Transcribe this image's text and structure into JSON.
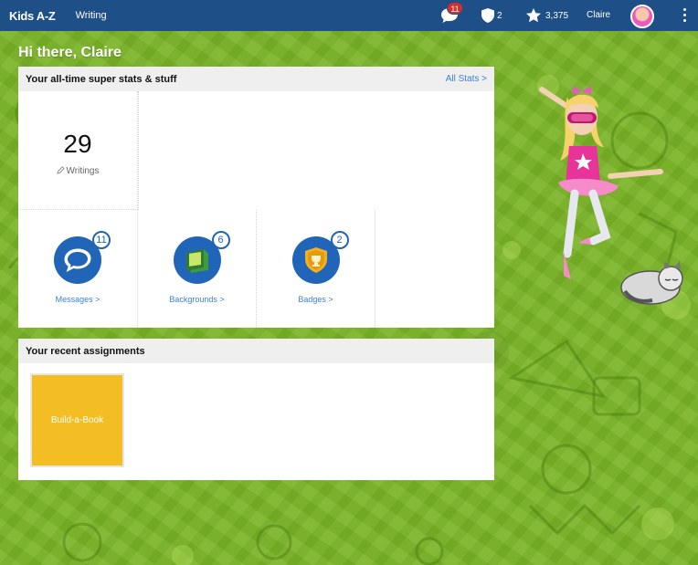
{
  "app": {
    "logo": "Kids A-Z",
    "mode": "Writing"
  },
  "topbar": {
    "messages_count": "11",
    "shields_count": "2",
    "stars_count": "3,375",
    "username": "Claire"
  },
  "greeting": "Hi there, Claire",
  "stats": {
    "title": "Your all-time super stats & stuff",
    "all_stats_link": "All Stats >",
    "writings_count": "29",
    "writings_label": "Writings",
    "messages": {
      "count": "11",
      "label": "Messages >"
    },
    "backgrounds": {
      "count": "6",
      "label": "Backgrounds >"
    },
    "badges": {
      "count": "2",
      "label": "Badges >"
    }
  },
  "assignments": {
    "title": "Your recent assignments",
    "items": [
      {
        "label": "Build-a-Book"
      }
    ]
  },
  "colors": {
    "topbar": "#1e4f87",
    "accent_blue": "#2165b8",
    "tile_yellow": "#f3be24",
    "background_green": "#7cb82c"
  }
}
